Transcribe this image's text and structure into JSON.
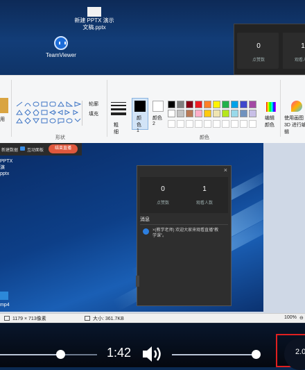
{
  "desktop": {
    "file_label": "新建 PPTX 演示文稿.pptx",
    "teamviewer_label": "TeamViewer"
  },
  "live_panel_top": {
    "likes_value": "0",
    "viewers_value": "1",
    "likes_label": "点赞数",
    "viewers_label": "观看人数"
  },
  "ribbon": {
    "left_partial": "用",
    "brush_label": "轮廓",
    "fill_label": "填充",
    "shapes_group": "形状",
    "size_label": "粗细",
    "color1_label": "颜色 1",
    "color2_label": "颜色 2",
    "colors_group": "颜色",
    "edit_colors_label": "编辑颜色",
    "paint3d_label": "使用画图 3D 进行编辑",
    "palette": [
      "#000000",
      "#7f7f7f",
      "#880015",
      "#ed1c24",
      "#ff7f27",
      "#fff200",
      "#22b14c",
      "#00a2e8",
      "#3f48cc",
      "#a349a4",
      "#ffffff",
      "#c3c3c3",
      "#b97a57",
      "#ffaec9",
      "#ffc90e",
      "#efe4b0",
      "#b5e61d",
      "#99d9ea",
      "#7092be",
      "#c8bfe7"
    ]
  },
  "inner_screen": {
    "tab1": "新建数据",
    "tab2": "互动面板",
    "live_button": "结束直播",
    "file_label": "PPTX 演\npptx",
    "video_label": "mp4",
    "likes_value": "0",
    "viewers_value": "1",
    "likes_label": "点赞数",
    "viewers_label": "观看人数",
    "messages_title": "消息",
    "message_text": "×(教学老师) 欢迎大家来观看直播“教学课”。"
  },
  "statusbar": {
    "dimensions": "1179 × 713像素",
    "size": "大小: 361.7KB",
    "zoom": "100%"
  },
  "player": {
    "time": "1:42",
    "speed": "2.0",
    "progress_fraction": 0.2,
    "volume_fraction": 0.84,
    "accent": "#e02020"
  }
}
